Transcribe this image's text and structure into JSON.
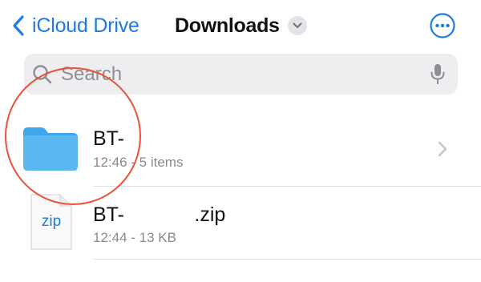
{
  "nav": {
    "back_label": "iCloud Drive",
    "title": "Downloads"
  },
  "search": {
    "placeholder": "Search"
  },
  "files": [
    {
      "name": "BT-",
      "meta": "12:46 - 5 items",
      "kind": "folder"
    },
    {
      "name_prefix": "BT-",
      "name_suffix": ".zip",
      "meta": "12:44 - 13 KB",
      "kind": "zip",
      "icon_label": "zip"
    }
  ],
  "colors": {
    "accent": "#1f7ae3",
    "folder": "#5ab7f0",
    "annotation": "#e8523a"
  }
}
